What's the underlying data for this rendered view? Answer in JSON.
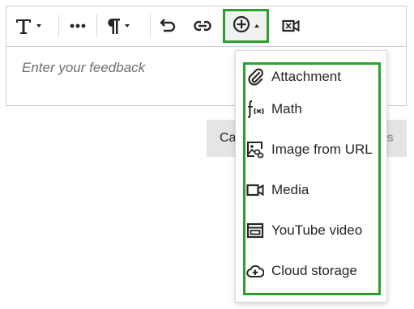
{
  "editor": {
    "placeholder": "Enter your feedback"
  },
  "toolbar": {
    "buttons": [
      {
        "name": "text-format",
        "icon": "text-format-icon"
      },
      {
        "name": "more",
        "icon": "more-dots-icon"
      },
      {
        "name": "paragraph",
        "icon": "paragraph-icon"
      },
      {
        "name": "undo",
        "icon": "undo-icon"
      },
      {
        "name": "link",
        "icon": "link-icon"
      },
      {
        "name": "insert",
        "icon": "add-circle-icon"
      },
      {
        "name": "media-recorder",
        "icon": "video-recorder-icon"
      }
    ]
  },
  "footer": {
    "cancel_label": "Ca",
    "save_label": "s"
  },
  "insert_menu": {
    "items": [
      {
        "label": "Attachment",
        "icon": "paperclip-icon"
      },
      {
        "label": "Math",
        "icon": "math-function-icon"
      },
      {
        "label": "Image from URL",
        "icon": "image-link-icon"
      },
      {
        "label": "Media",
        "icon": "video-camera-icon"
      },
      {
        "label": "YouTube video",
        "icon": "youtube-frame-icon"
      },
      {
        "label": "Cloud storage",
        "icon": "cloud-upload-icon"
      }
    ]
  },
  "colors": {
    "highlight": "#2e9e2e",
    "border": "#cdcdcd",
    "text": "#262626",
    "placeholder": "#6f6f6f",
    "button_bg": "#e5e5e5"
  }
}
